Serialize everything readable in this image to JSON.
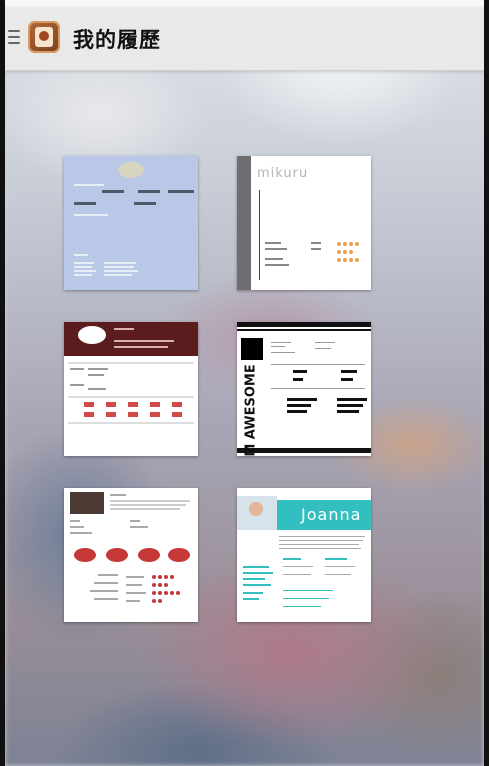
{
  "app_bar": {
    "title": "我的履歷"
  },
  "templates": [
    {
      "name": "resume-template-1",
      "label": ""
    },
    {
      "name": "resume-template-2",
      "label": "mikuru"
    },
    {
      "name": "resume-template-3",
      "label": ""
    },
    {
      "name": "resume-template-4",
      "label": "I'M AWESOME"
    },
    {
      "name": "resume-template-5",
      "label": ""
    },
    {
      "name": "resume-template-6",
      "label": "Joanna"
    }
  ],
  "colors": {
    "app_bar": "#e9e9e9",
    "template1_bg": "#b8c8e6",
    "template3_header": "#5a1c1c",
    "template6_accent": "#33bfbf"
  },
  "icons": {
    "menu": "hamburger-icon",
    "app": "app-logo-icon"
  }
}
